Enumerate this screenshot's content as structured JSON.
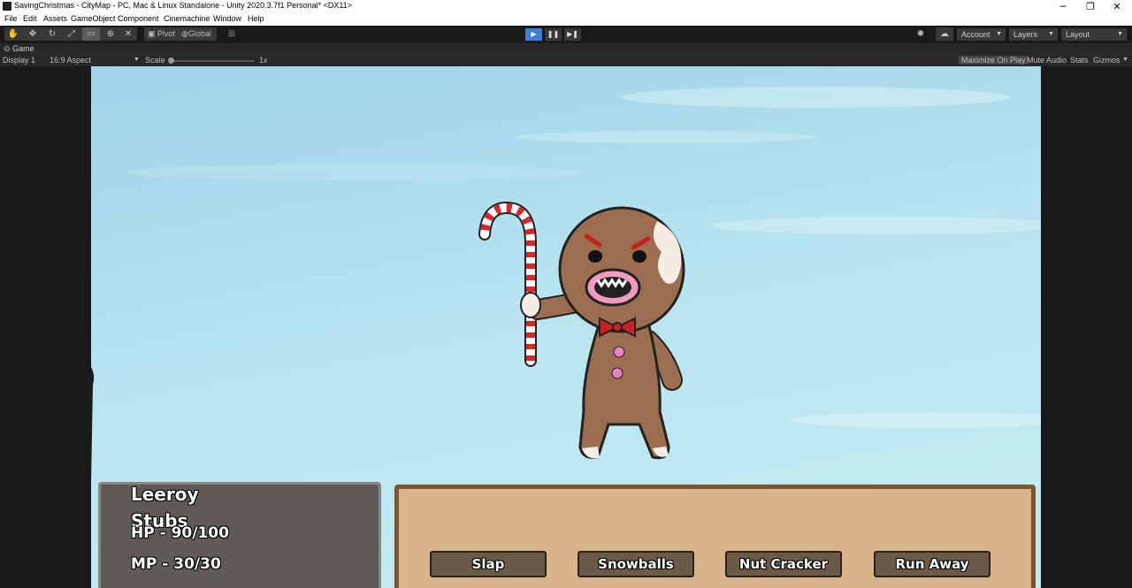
{
  "window": {
    "title": "SavingChristmas - CityMap - PC, Mac & Linux Standalone - Unity 2020.3.7f1 Personal* <DX11>",
    "controls": {
      "minimize": "─",
      "restore": "❐",
      "close": "✕"
    }
  },
  "menu": [
    "File",
    "Edit",
    "Assets",
    "GameObject",
    "Component",
    "Cinemachine",
    "Window",
    "Help"
  ],
  "toolbar": {
    "pivot_label": "Pivot",
    "global_label": "Global",
    "account_label": "Account",
    "layers_label": "Layers",
    "layout_label": "Layout",
    "play_active": true
  },
  "game_view": {
    "tab_label": "Game",
    "display": "Display 1",
    "aspect": "16:9 Aspect",
    "scale_label": "Scale",
    "scale_value": "1x",
    "options": [
      "Maximize On Play",
      "Mute Audio",
      "Stats",
      "Gizmos"
    ]
  },
  "hud": {
    "character_name": "Leeroy",
    "character_subname": "Stubs",
    "hp": "HP - 90/100",
    "mp": "MP - 30/30",
    "actions": [
      "Slap",
      "Snowballs",
      "Nut Cracker",
      "Run Away"
    ]
  },
  "enemy": {
    "description_icon": "gingerbread-man-icon",
    "weapon_icon": "candy-cane-icon"
  },
  "colors": {
    "accent_blue": "#3f7fd4",
    "editor_dark": "#191919",
    "panel_wood": "#d9b48a"
  }
}
